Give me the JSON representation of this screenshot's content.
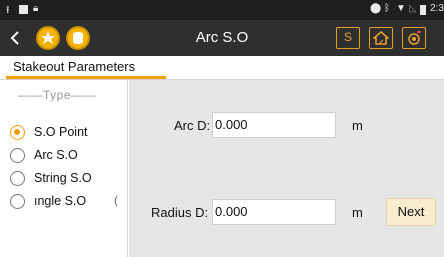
{
  "status_bar": {
    "time": "2:3"
  },
  "header": {
    "title": "Arc S.O",
    "back_icon": "chevron-left-icon",
    "buttons": [
      {
        "label": "S",
        "icon": "survey-s-icon"
      },
      {
        "label": "",
        "icon": "house-icon"
      },
      {
        "label": "",
        "icon": "target-settings-icon"
      }
    ]
  },
  "tabs": {
    "active": "Stakeout Parameters"
  },
  "type_panel": {
    "header": "——Type——",
    "options": [
      {
        "label": "S.O Point",
        "selected": true
      },
      {
        "label": "Arc S.O",
        "selected": false
      },
      {
        "label": "String S.O",
        "selected": false
      },
      {
        "label": "ıngle S.O",
        "selected": false
      }
    ],
    "partial_text": "("
  },
  "form": {
    "arc_d": {
      "label": "Arc D:",
      "value": "0.000",
      "unit": "m"
    },
    "radius_d": {
      "label": "Radius D:",
      "value": "0.000",
      "unit": "m"
    },
    "next_label": "Next"
  },
  "colors": {
    "accent": "#f39c12",
    "topbar_bg": "#2f2f2f",
    "statusbar_bg": "#1f1f1f",
    "panel_bg": "#e6e6e6"
  }
}
